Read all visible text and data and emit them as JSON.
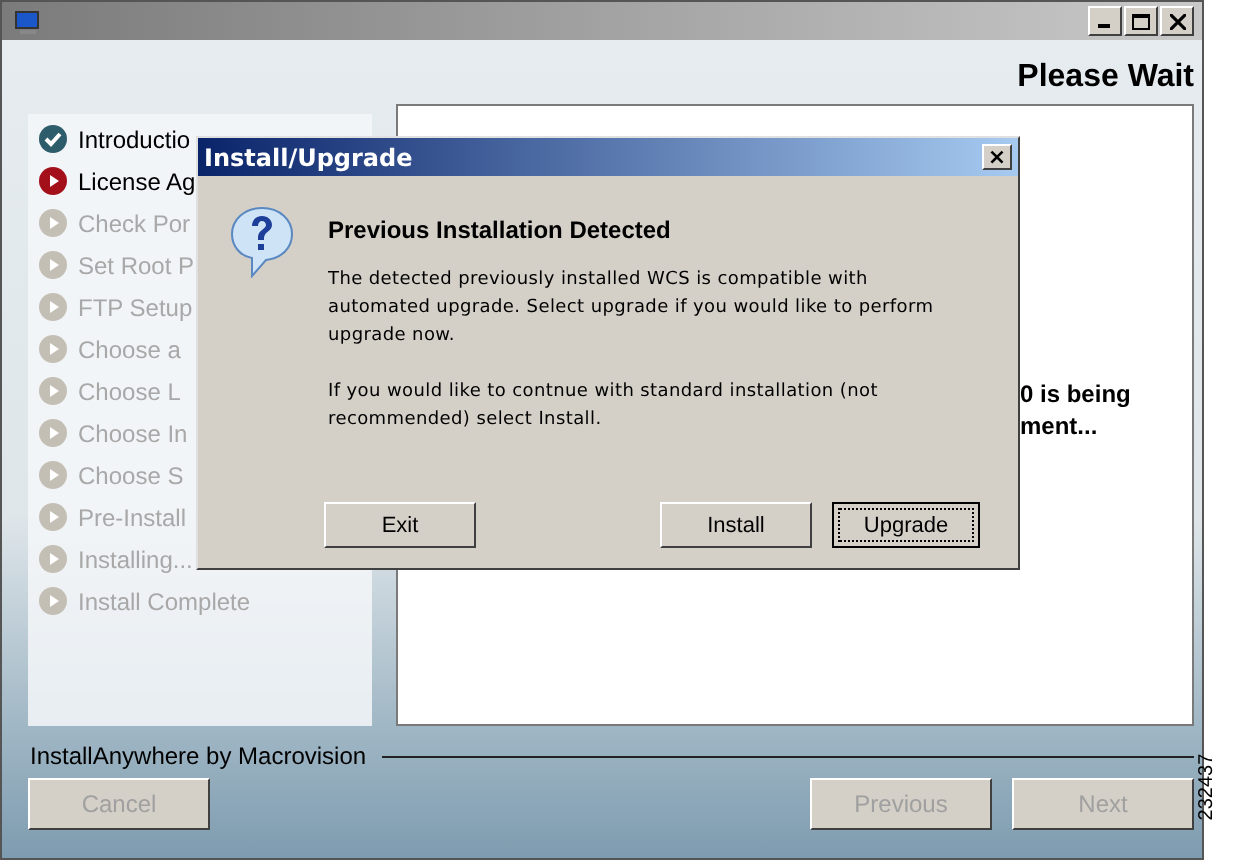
{
  "window": {
    "heading": "Please Wait"
  },
  "steps": [
    {
      "label": "Introductio",
      "kind": "done"
    },
    {
      "label": "License Ag",
      "kind": "current"
    },
    {
      "label": "Check Por",
      "kind": "pending"
    },
    {
      "label": "Set Root P",
      "kind": "pending"
    },
    {
      "label": "FTP Setup",
      "kind": "pending"
    },
    {
      "label": "Choose a",
      "kind": "pending"
    },
    {
      "label": "Choose L",
      "kind": "pending"
    },
    {
      "label": "Choose In",
      "kind": "pending"
    },
    {
      "label": "Choose S",
      "kind": "pending"
    },
    {
      "label": "Pre-Install",
      "kind": "pending"
    },
    {
      "label": "Installing...",
      "kind": "pending"
    },
    {
      "label": "Install Complete",
      "kind": "pending"
    }
  ],
  "content": {
    "lines": [
      "0 is being",
      "ment..."
    ]
  },
  "footer": {
    "brand": "InstallAnywhere by Macrovision",
    "buttons": [
      {
        "label": "Cancel",
        "disabled": true
      },
      {
        "label": "Previous",
        "disabled": true
      },
      {
        "label": "Next",
        "disabled": true
      }
    ]
  },
  "dialog": {
    "title": "Install/Upgrade",
    "close": "×",
    "heading": "Previous Installation Detected",
    "paragraphs": [
      "The detected previously installed WCS is compatible with automated upgrade.  Select upgrade if you would like to perform upgrade now.",
      "If you would like to contnue with standard installation (not recommended) select Install."
    ],
    "buttons": [
      {
        "label": "Exit",
        "focused": false
      },
      {
        "label": "Install",
        "focused": false
      },
      {
        "label": "Upgrade",
        "focused": true
      }
    ]
  },
  "side_number": "232437"
}
